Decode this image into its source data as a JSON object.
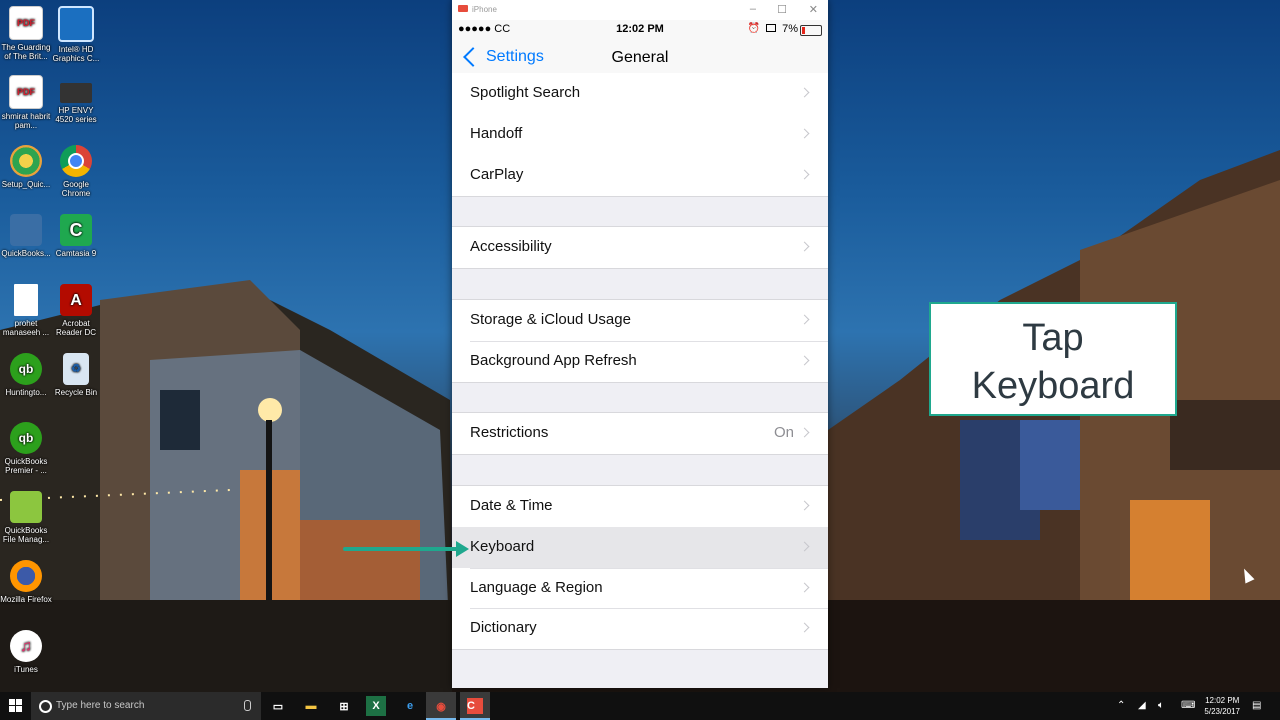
{
  "desktop": {
    "icons": [
      {
        "label": "The Guarding of The Brit...",
        "icon": "pdf-icon"
      },
      {
        "label": "Intel® HD Graphics C...",
        "icon": "intel-graphics-icon"
      },
      {
        "label": "shmirat habrit pam...",
        "icon": "pdf-icon"
      },
      {
        "label": "HP ENVY 4520 series",
        "icon": "printer-icon"
      },
      {
        "label": "Setup_Quic...",
        "icon": "setup-icon"
      },
      {
        "label": "Google Chrome",
        "icon": "chrome-icon"
      },
      {
        "label": "QuickBooks...",
        "icon": "quickbooks-workbench-icon"
      },
      {
        "label": "Camtasia 9",
        "icon": "camtasia-icon"
      },
      {
        "label": "prohet manaseeh ...",
        "icon": "document-icon"
      },
      {
        "label": "Acrobat Reader DC",
        "icon": "acrobat-icon"
      },
      {
        "label": "Huntingto...",
        "icon": "quickbooks-icon"
      },
      {
        "label": "Recycle Bin",
        "icon": "recycle-bin-icon"
      },
      {
        "label": "QuickBooks Premier - ...",
        "icon": "quickbooks-icon"
      },
      {
        "label": "QuickBooks File Manag...",
        "icon": "file-manager-icon"
      },
      {
        "label": "Mozilla Firefox",
        "icon": "firefox-icon"
      },
      {
        "label": "iTunes",
        "icon": "itunes-icon"
      }
    ]
  },
  "window": {
    "title": "iPhone",
    "status": {
      "carrier": "●●●●● CC",
      "time": "12:02 PM",
      "battery": "7%"
    },
    "nav": {
      "back_label": "Settings",
      "title": "General"
    },
    "rows": [
      {
        "label": "Spotlight Search",
        "detail": ""
      },
      {
        "label": "Handoff",
        "detail": ""
      },
      {
        "label": "CarPlay",
        "detail": ""
      },
      {
        "label": "Accessibility",
        "detail": ""
      },
      {
        "label": "Storage & iCloud Usage",
        "detail": ""
      },
      {
        "label": "Background App Refresh",
        "detail": ""
      },
      {
        "label": "Restrictions",
        "detail": "On"
      },
      {
        "label": "Date & Time",
        "detail": ""
      },
      {
        "label": "Keyboard",
        "detail": ""
      },
      {
        "label": "Language & Region",
        "detail": ""
      },
      {
        "label": "Dictionary",
        "detail": ""
      }
    ],
    "highlighted_row": "Keyboard"
  },
  "callout": {
    "line1": "Tap",
    "line2": "Keyboard"
  },
  "colors": {
    "accent": "#1fa88e",
    "ios_blue": "#007aff"
  },
  "taskbar": {
    "search_placeholder": "Type here to search",
    "clock_time": "12:02 PM",
    "clock_date": "5/23/2017"
  }
}
